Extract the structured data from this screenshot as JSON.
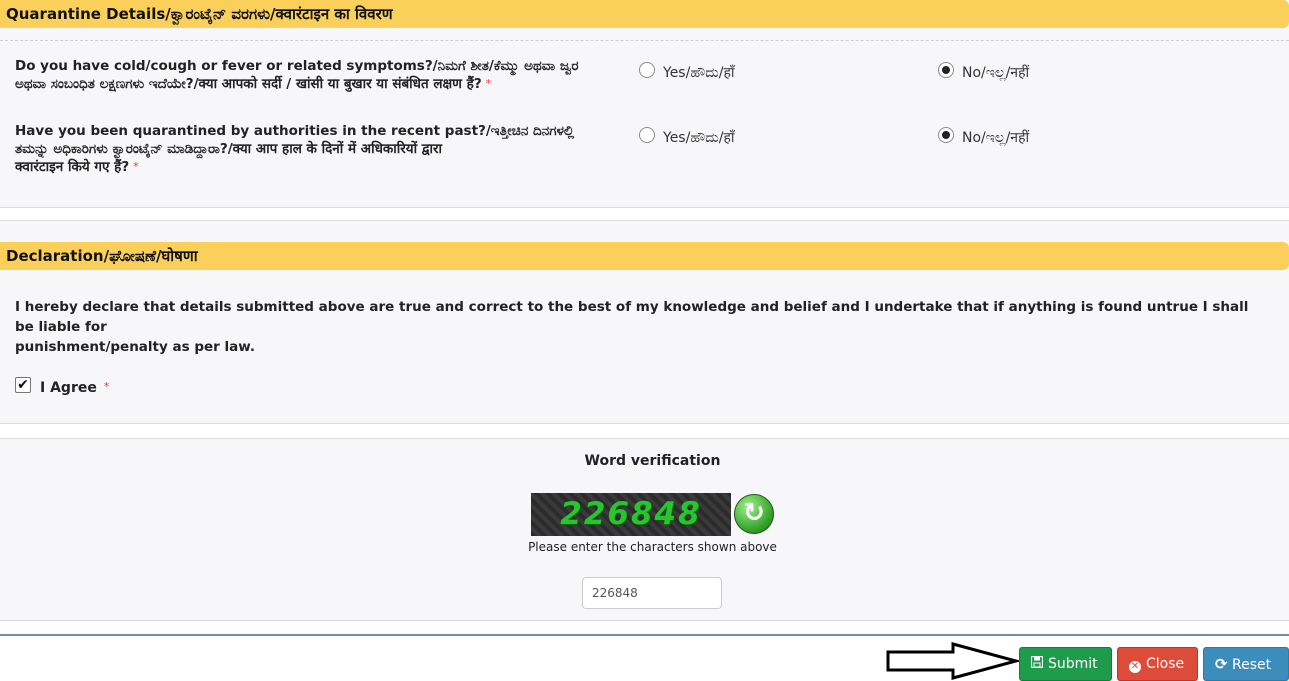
{
  "quarantine": {
    "heading": "Quarantine Details/ಕ್ವಾರಂಟೈನ್ ವರಗಳು/क्वारंटाइन का विवरण",
    "q1": {
      "line1": "Do you have cold/cough or fever or related symptoms?/ನಿಮಗೆ ಶೀತ/ಕೆಮ್ಮು ಅಥವಾ ಜ್ವರ",
      "line2": "ಅಥವಾ ಸಂಬಂಧಿತ ಲಕ್ಷಣಗಳು ಇದೆಯೇ?/क्या आपको सर्दी / खांसी या बुखार या संबंधित लक्षण हैं?",
      "required": "*",
      "yes_label": "Yes/ಹೌದು/हाँ",
      "no_label": "No/ಇಲ್ಲ/नहीं",
      "selected": "No"
    },
    "q2": {
      "line1": "Have you been quarantined by authorities in the recent past?/ಇತ್ತೀಚಿನ ದಿನಗಳಲ್ಲಿ",
      "line2": "ತಮನ್ನು ಅಧಿಕಾರಿಗಳು ಕ್ವಾರಂಟೈನ್ ಮಾಡಿದ್ದಾರಾ?/क्या आप हाल के दिनों में अधिकारियों द्वारा",
      "line3": "क्वारंटाइन किये गए हैं?",
      "required": "*",
      "yes_label": "Yes/ಹೌದು/हाँ",
      "no_label": "No/ಇಲ್ಲ/नहीं",
      "selected": "No"
    }
  },
  "declaration": {
    "heading": "Declaration/ಘೋಷಣೆ/घोषणा",
    "line1": "I hereby declare that details submitted above are true and correct to the best of my knowledge and belief and I undertake that if anything is found untrue I shall be liable for",
    "line2": "punishment/penalty as per law.",
    "agree_label": "I Agree",
    "agree_required": "*",
    "agree_checked": true,
    "check_glyph": "✔"
  },
  "verification": {
    "title": "Word verification",
    "captcha_text": "226848",
    "refresh_glyph": "↻",
    "hint": "Please enter the characters shown above",
    "input_value": "226848"
  },
  "actions": {
    "submit_label": "Submit",
    "close_label": "Close",
    "reset_label": "Reset",
    "submit_icon": "save-icon",
    "close_icon": "close-circle-icon",
    "reset_icon": "refresh-icon"
  },
  "colors": {
    "header_bar": "#fad05b",
    "submit": "#1f9b4c",
    "close": "#dd4b39",
    "reset": "#3c8dbc",
    "captcha_text": "#27c52f"
  }
}
